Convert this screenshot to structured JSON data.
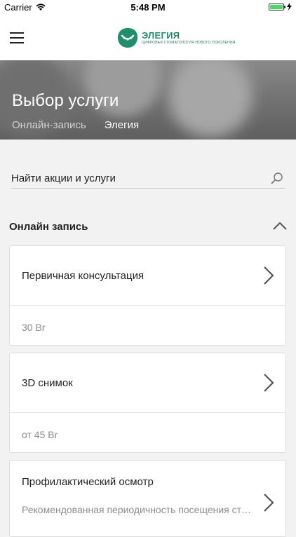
{
  "statusbar": {
    "carrier": "Carrier",
    "time": "5:48 PM"
  },
  "navbar": {
    "logo_name": "ЭЛЕГИЯ",
    "logo_sub": "ЦИФРОВАЯ СТОМАТОЛОГИЯ НОВОГО ПОКОЛЕНИЯ"
  },
  "hero": {
    "title": "Выбор услуги",
    "tabs": [
      "Онлайн-запись",
      "Элегия"
    ],
    "active_tab": "Элегия"
  },
  "search": {
    "placeholder": "Найти акции и услуги"
  },
  "section": {
    "title": "Онлайн запись"
  },
  "services": [
    {
      "name": "Первичная консультация",
      "price": "30 Br"
    },
    {
      "name": "3D снимок",
      "price": "от 45 Br"
    },
    {
      "name": "Профилактический осмотр",
      "description": "Рекомендованная периодичность посещения стоматолога"
    }
  ],
  "colors": {
    "brand": "#1e8f6a",
    "battery": "#4cd964"
  }
}
